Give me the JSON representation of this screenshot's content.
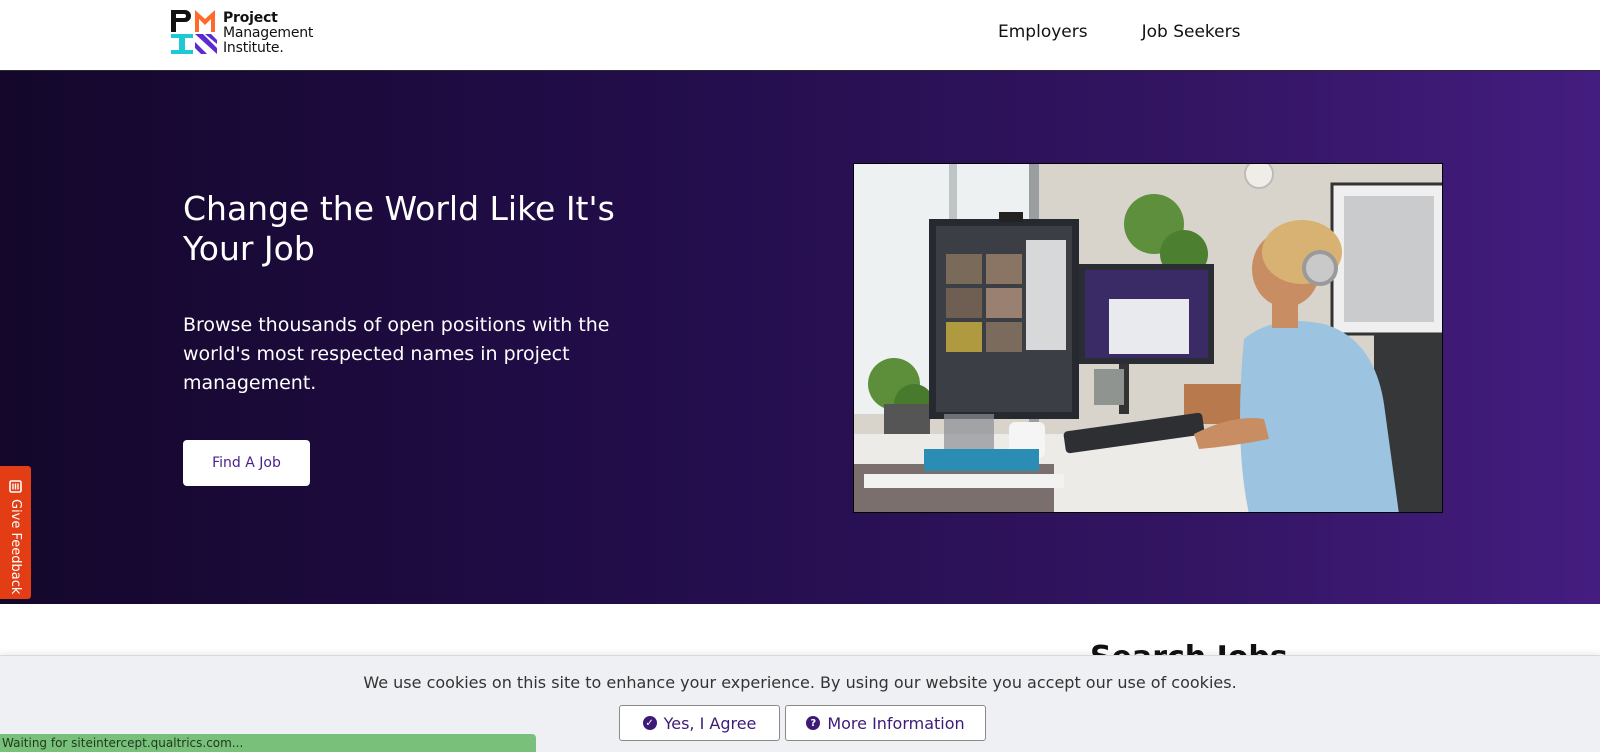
{
  "header": {
    "logo_lines": [
      "Project",
      "Management",
      "Institute."
    ],
    "nav": [
      {
        "label": "Employers"
      },
      {
        "label": "Job Seekers"
      }
    ]
  },
  "hero": {
    "title": "Change the World Like It's Your Job",
    "subtitle": "Browse thousands of open positions with the world's most respected names in project management.",
    "cta_label": "Find A Job",
    "background_colors": [
      "#14072b",
      "#441d80"
    ]
  },
  "feedback": {
    "label": "Give Feedback",
    "icon": "clipboard-icon",
    "color": "#e23d14"
  },
  "below_fold": {
    "partial_heading": "Search Jobs"
  },
  "cookie_banner": {
    "message": "We use cookies on this site to enhance your experience. By using our website you accept our use of cookies.",
    "agree_label": "Yes, I Agree",
    "agree_icon": "check-circle-icon",
    "info_label": "More Information",
    "info_icon": "question-circle-icon"
  },
  "status_bar": {
    "text": "Waiting for siteintercept.qualtrics.com..."
  }
}
